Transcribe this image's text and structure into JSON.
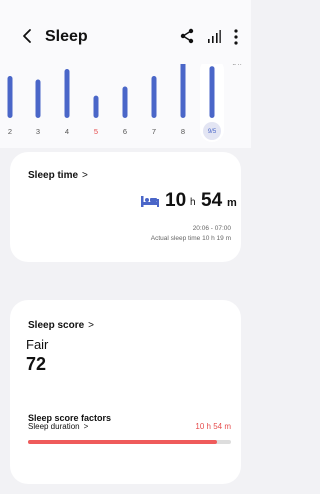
{
  "header": {
    "title": "Sleep"
  },
  "chart_data": {
    "type": "bar",
    "categories": [
      "2",
      "3",
      "4",
      "5",
      "6",
      "7",
      "8",
      "9/5"
    ],
    "values": [
      6.0,
      5.5,
      7.0,
      3.2,
      4.5,
      6.0,
      8.8,
      7.4
    ],
    "highlight_category": "5",
    "selected_category": "9/5",
    "ytick_label": "8 h",
    "ytick_value": 8,
    "ylim": [
      0,
      10
    ],
    "colors": {
      "bar": "#4a66c8",
      "highlight_label": "#e64c4c",
      "selected_bg": "#e3e5f3"
    }
  },
  "sleep_time": {
    "title": "Sleep time",
    "hours": "10",
    "hours_unit": "h",
    "minutes": "54",
    "minutes_unit": "m",
    "range": "20:06 - 07:00",
    "actual": "Actual sleep time 10 h 19 m"
  },
  "sleep_score": {
    "title": "Sleep score",
    "rating": "Fair",
    "score": "72"
  },
  "factors": {
    "title": "Sleep score factors",
    "items": [
      {
        "label": "Sleep duration",
        "value": "10 h 54 m",
        "progress": 0.93
      }
    ]
  },
  "icons": [
    "back-icon",
    "share-icon",
    "stats-icon",
    "more-icon",
    "sleep-icon",
    "chevron-right-icon"
  ]
}
